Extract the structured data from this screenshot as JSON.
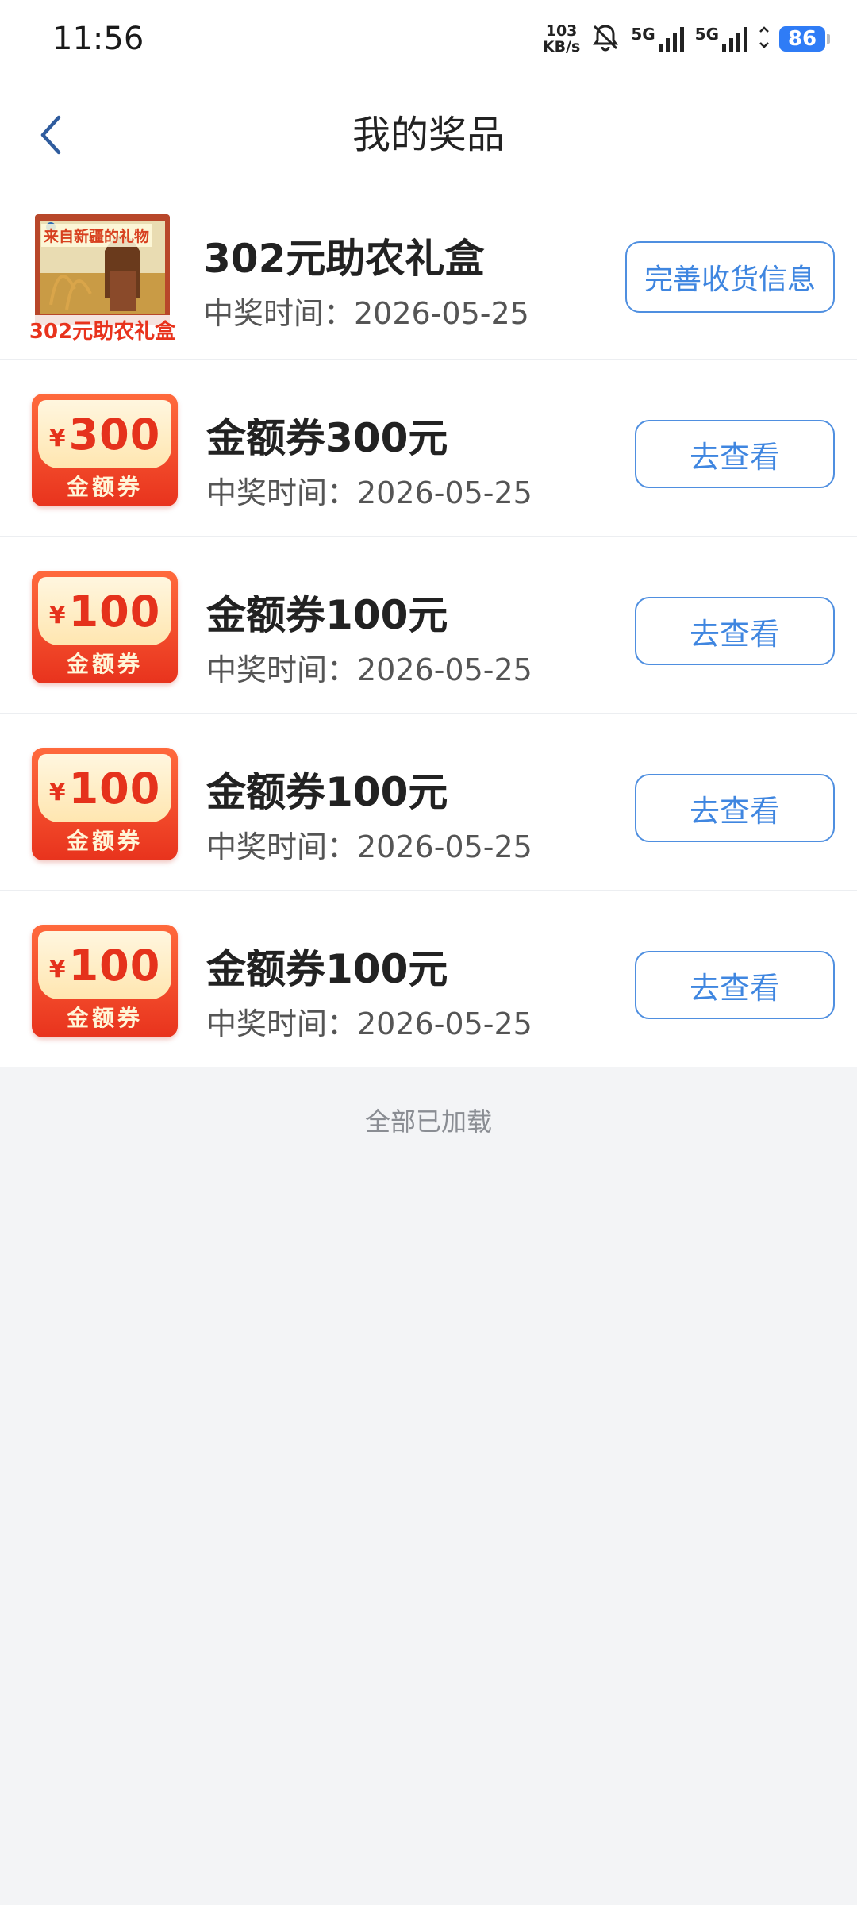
{
  "status_bar": {
    "time": "11:56",
    "net_speed_value": "103",
    "net_speed_unit": "KB/s",
    "sim1": "5G",
    "sim2": "5G",
    "battery": "86",
    "icons": [
      "bell-muted-icon",
      "signal-icon",
      "wifi-icon",
      "battery-icon"
    ]
  },
  "nav": {
    "title": "我的奖品",
    "back_icon": "chevron-left-icon"
  },
  "prizes": [
    {
      "title": "302元助农礼盒",
      "time": "中奖时间：2026-05-25",
      "action": "完善收货信息",
      "image_text": "302元助农礼盒",
      "image_header": "来自新疆的礼物"
    },
    {
      "title": "金额券300元",
      "time": "中奖时间：2026-05-25",
      "action": "去查看",
      "coupon_symbol": "¥",
      "coupon_amount": "300",
      "coupon_label": "金额券"
    },
    {
      "title": "金额券100元",
      "time": "中奖时间：2026-05-25",
      "action": "去查看",
      "coupon_symbol": "¥",
      "coupon_amount": "100",
      "coupon_label": "金额券"
    },
    {
      "title": "金额券100元",
      "time": "中奖时间：2026-05-25",
      "action": "去查看",
      "coupon_symbol": "¥",
      "coupon_amount": "100",
      "coupon_label": "金额券"
    },
    {
      "title": "金额券100元",
      "time": "中奖时间：2026-05-25",
      "action": "去查看",
      "coupon_symbol": "¥",
      "coupon_amount": "100",
      "coupon_label": "金额券"
    }
  ],
  "footer": "全部已加载",
  "colors": {
    "accent": "#3f86e0",
    "coupon_red": "#e8331d",
    "background": "#f3f4f6"
  }
}
